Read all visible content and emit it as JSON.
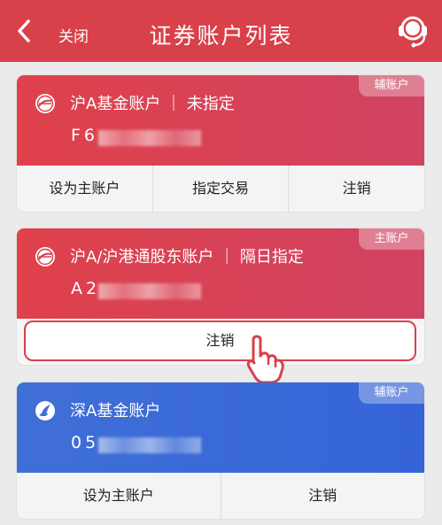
{
  "header": {
    "title": "证券账户列表",
    "close_label": "关闭",
    "back_icon": "chevron-left-icon",
    "service_icon": "customer-service-icon"
  },
  "accounts": [
    {
      "name": "沪A基金账户 ｜ 未指定",
      "number": "F6",
      "badge": "辅账户",
      "actions": [
        "设为主账户",
        "指定交易",
        "注销"
      ],
      "logo": "sse-logo"
    },
    {
      "name": "沪A/沪港通股东账户 ｜ 隔日指定",
      "number": "A2",
      "badge": "主账户",
      "actions": [
        "注销"
      ],
      "logo": "sse-logo"
    },
    {
      "name": "深A基金账户",
      "number": "05",
      "badge": "辅账户",
      "actions": [
        "设为主账户",
        "注销"
      ],
      "logo": "szse-logo"
    }
  ],
  "colors": {
    "brand_red": "#d8404a",
    "card_blue": "#3f6fd6",
    "background": "#ebebeb"
  }
}
